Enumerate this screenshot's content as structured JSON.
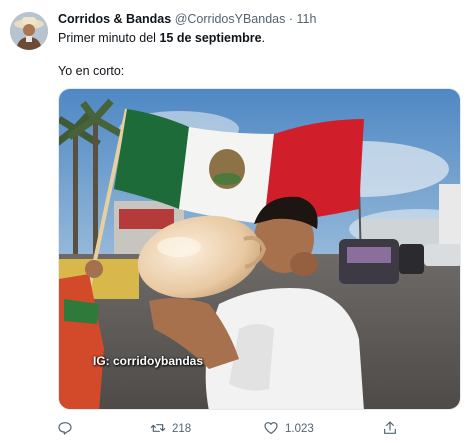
{
  "author": {
    "name": "Corridos & Bandas",
    "handle": "@CorridosYBandas",
    "separator": "·",
    "time": "11h"
  },
  "tweet": {
    "line1_prefix": "Primer minuto del ",
    "line1_bold": "15 de septiembre",
    "line1_suffix": ".",
    "line2": "Yo en corto:"
  },
  "media": {
    "watermark": "IG: corridoybandas"
  },
  "actions": {
    "reply_icon": "reply-icon",
    "retweet_icon": "retweet-icon",
    "retweet_count": "218",
    "like_icon": "heart-icon",
    "like_count": "1.023",
    "share_icon": "share-icon"
  },
  "colors": {
    "text": "#0f1419",
    "secondary": "#536471",
    "flag_green": "#1e6b3a",
    "flag_white": "#f4f4f2",
    "flag_red": "#d01f2a"
  }
}
